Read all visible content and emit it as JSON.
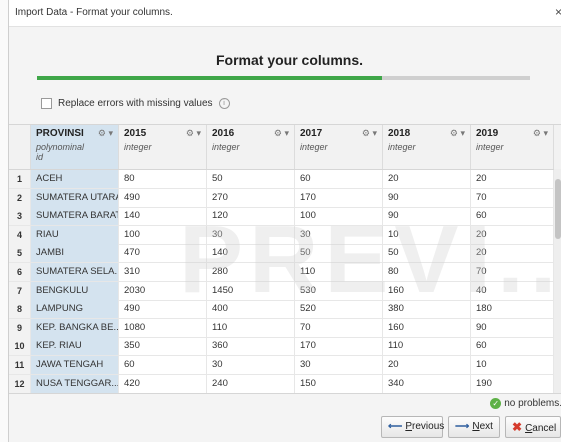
{
  "window": {
    "title": "Import Data - Format your columns.",
    "close_glyph": "×"
  },
  "heading": "Format your columns.",
  "progress": {
    "fraction": 0.7
  },
  "options": {
    "replace_errors_label": "Replace errors with missing values",
    "replace_errors_checked": false
  },
  "table": {
    "columns": [
      {
        "name": "PROVINSI",
        "type": "polynominal",
        "role": "id"
      },
      {
        "name": "2015",
        "type": "integer"
      },
      {
        "name": "2016",
        "type": "integer"
      },
      {
        "name": "2017",
        "type": "integer"
      },
      {
        "name": "2018",
        "type": "integer"
      },
      {
        "name": "2019",
        "type": "integer"
      }
    ],
    "rows": [
      {
        "n": "1",
        "cells": [
          "ACEH",
          "80",
          "50",
          "60",
          "20",
          "20"
        ]
      },
      {
        "n": "2",
        "cells": [
          "SUMATERA UTARA",
          "490",
          "270",
          "170",
          "90",
          "70"
        ]
      },
      {
        "n": "3",
        "cells": [
          "SUMATERA BARAT",
          "140",
          "120",
          "100",
          "90",
          "60"
        ]
      },
      {
        "n": "4",
        "cells": [
          "RIAU",
          "100",
          "30",
          "30",
          "10",
          "20"
        ]
      },
      {
        "n": "5",
        "cells": [
          "JAMBI",
          "470",
          "140",
          "50",
          "50",
          "20"
        ]
      },
      {
        "n": "6",
        "cells": [
          "SUMATERA SELA...",
          "310",
          "280",
          "110",
          "80",
          "70"
        ]
      },
      {
        "n": "7",
        "cells": [
          "BENGKULU",
          "2030",
          "1450",
          "530",
          "160",
          "40"
        ]
      },
      {
        "n": "8",
        "cells": [
          "LAMPUNG",
          "490",
          "400",
          "520",
          "380",
          "180"
        ]
      },
      {
        "n": "9",
        "cells": [
          "KEP. BANGKA BE...",
          "1080",
          "110",
          "70",
          "160",
          "90"
        ]
      },
      {
        "n": "10",
        "cells": [
          "KEP. RIAU",
          "350",
          "360",
          "170",
          "110",
          "60"
        ]
      },
      {
        "n": "11",
        "cells": [
          "JAWA TENGAH",
          "60",
          "30",
          "30",
          "20",
          "10"
        ]
      },
      {
        "n": "12",
        "cells": [
          "NUSA TENGGAR...",
          "420",
          "240",
          "150",
          "340",
          "190"
        ]
      }
    ]
  },
  "status": {
    "text": "no problems.",
    "icon": "check-circle-icon"
  },
  "buttons": {
    "previous": {
      "prefix": "",
      "mnemonic": "P",
      "rest": "revious"
    },
    "next": {
      "mnemonic": "N",
      "rest": "ext"
    },
    "cancel": {
      "mnemonic": "C",
      "rest": "ancel"
    }
  },
  "watermark": "PREVI...",
  "colors": {
    "accent": "#3fa648",
    "id_column": "#d4e3ef",
    "cancel_x": "#d53b2c"
  }
}
